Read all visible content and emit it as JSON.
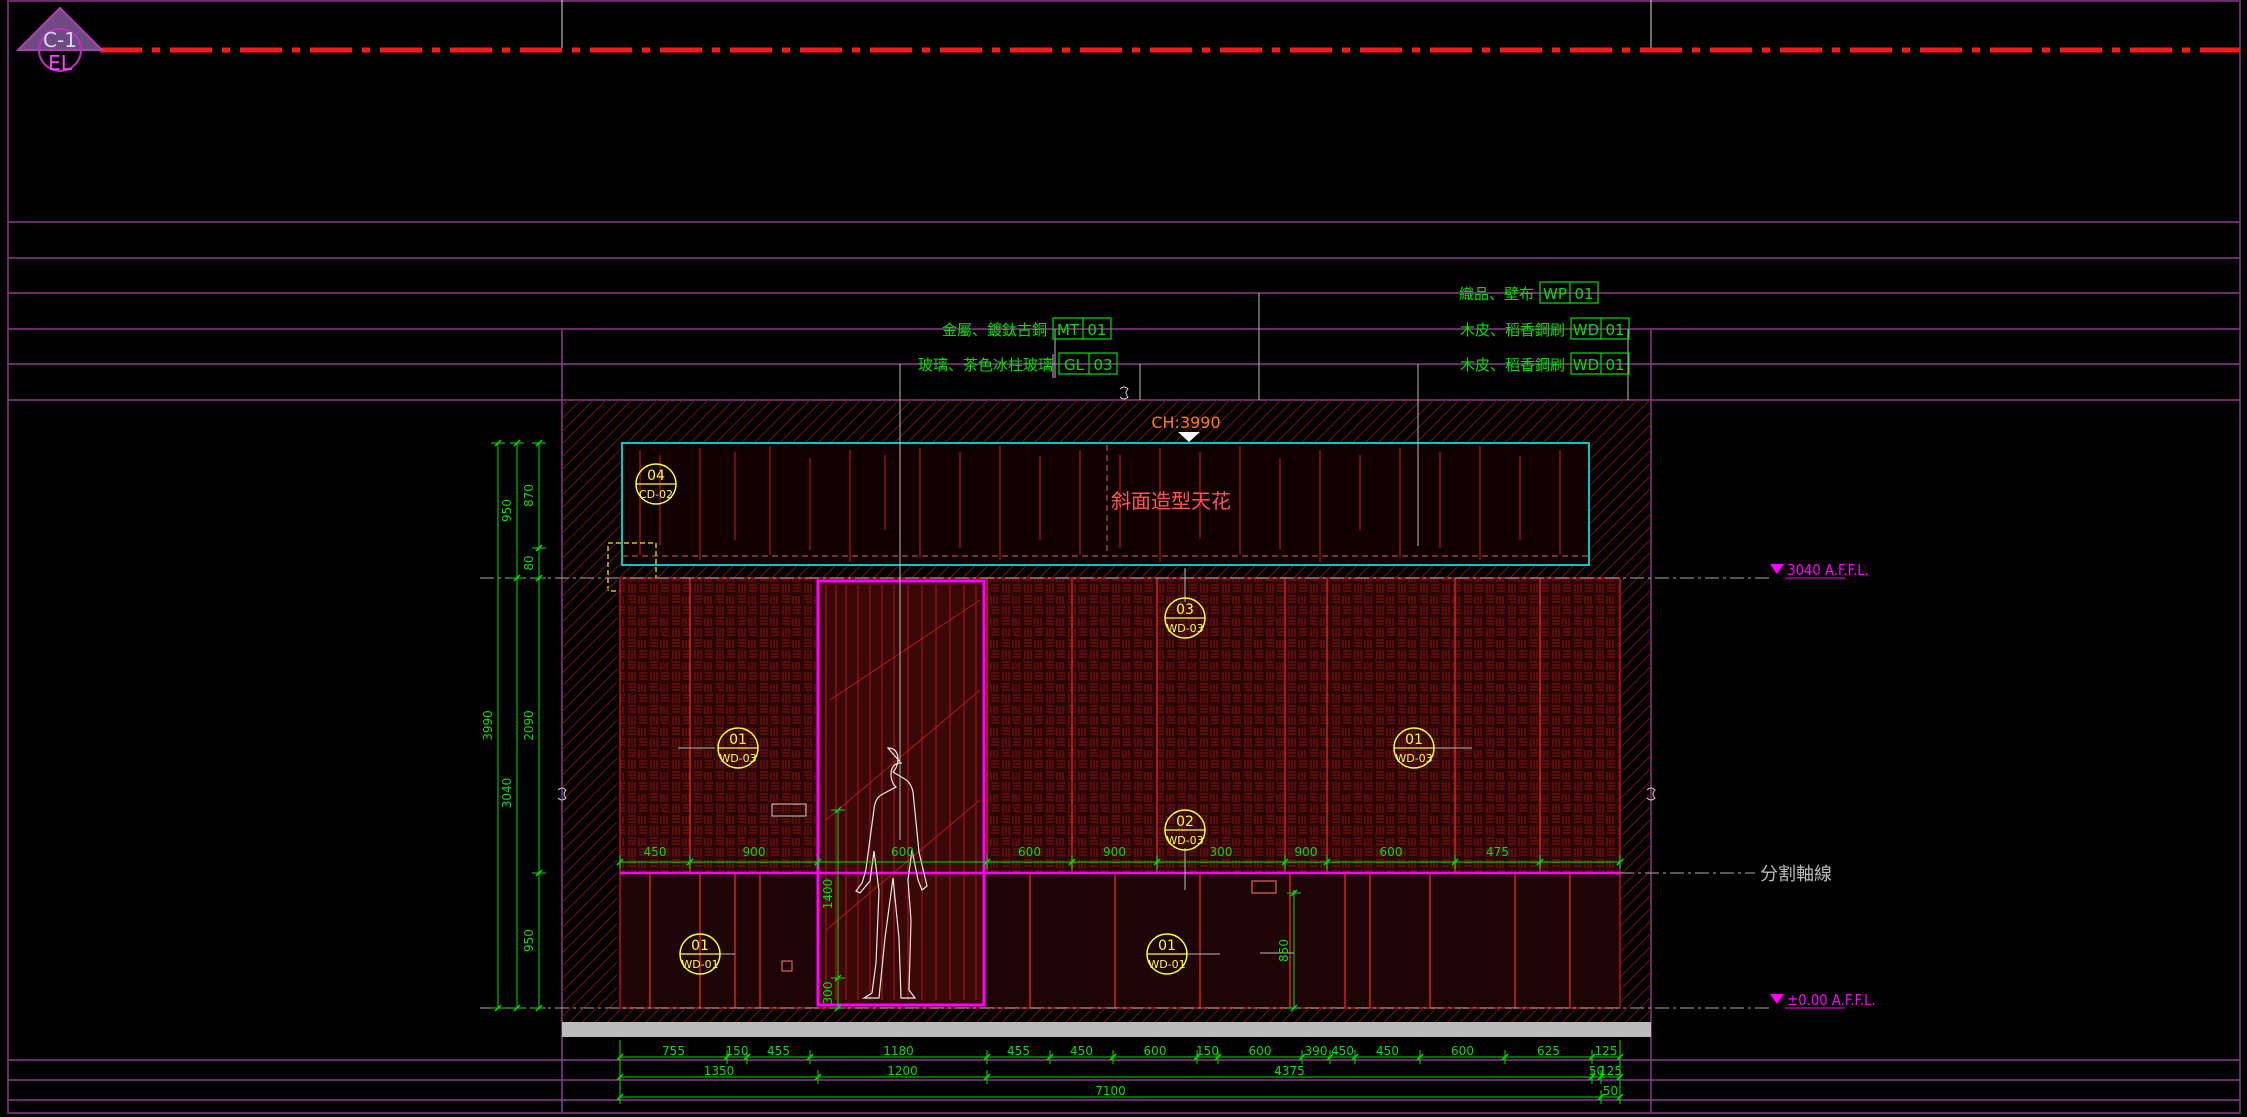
{
  "section_marker": {
    "top": "C-1",
    "bottom": "EL"
  },
  "ceiling": {
    "height_label": "CH:3990",
    "feature_label": "斜面造型天花"
  },
  "levels": {
    "ceiling_level": "3040 A.F.F.L.",
    "floor_level": "±0.00 A.F.F.L."
  },
  "split_line_label": "分割軸線",
  "material_callouts": [
    {
      "desc": "金屬、鍍鈦古銅",
      "code": "MT",
      "num": "01"
    },
    {
      "desc": "玻璃、茶色冰柱玻璃",
      "code": "GL",
      "num": "03"
    },
    {
      "desc": "織品、壁布",
      "code": "WP",
      "num": "01"
    },
    {
      "desc": "木皮、稻香鋼刷",
      "code": "WD",
      "num": "01"
    },
    {
      "desc": "木皮、稻香鋼刷",
      "code": "WD",
      "num": "01"
    }
  ],
  "detail_tags": [
    {
      "num": "04",
      "ref": "CD-02"
    },
    {
      "num": "03",
      "ref": "WD-03"
    },
    {
      "num": "01",
      "ref": "WD-03"
    },
    {
      "num": "01",
      "ref": "WD-03"
    },
    {
      "num": "02",
      "ref": "WD-03"
    },
    {
      "num": "01",
      "ref": "WD-01"
    },
    {
      "num": "01",
      "ref": "WD-01"
    }
  ],
  "vertical_dims": {
    "outer": [
      "3990"
    ],
    "middle": [
      "950",
      "3040"
    ],
    "inner": [
      "870",
      "80",
      "2090",
      "950"
    ],
    "door": [
      "1400",
      "300"
    ],
    "misc": [
      "850"
    ]
  },
  "panel_dims": [
    "450",
    "900",
    "600",
    "600",
    "900",
    "300",
    "900",
    "600",
    "475"
  ],
  "bottom_dims_row1": [
    "755",
    "150",
    "455",
    "1180",
    "455",
    "450",
    "600",
    "150",
    "600",
    "390",
    "450",
    "450",
    "600",
    "625",
    "125"
  ],
  "bottom_dims_row2": [
    "1350",
    "1200",
    "4375",
    "50",
    "125"
  ],
  "bottom_dims_row3": [
    "7100",
    "50"
  ],
  "colors": {
    "background": "#000000",
    "frame": "#8a3a8a",
    "cutline": "#ff1a1a",
    "wall_line": "#b81414",
    "dimension": "#00e000",
    "magenta": "#ff00ff",
    "tag": "#ffff33",
    "ceiling_outline": "#00c8c8",
    "orange": "#ff7a1a"
  }
}
